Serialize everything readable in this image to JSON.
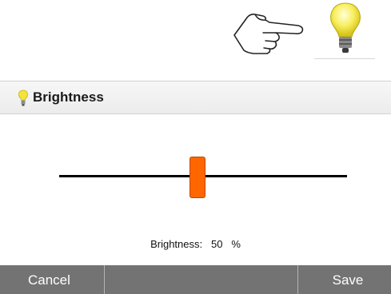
{
  "icons": {
    "pointer": "pointing-hand-icon",
    "lightbulb": "lightbulb-icon"
  },
  "dialog": {
    "title": "Brightness",
    "brightness_label": "Brightness:",
    "brightness_value": "50",
    "brightness_unit": "%"
  },
  "slider": {
    "value_fraction": 0.48,
    "thumb_color": "#ff6600",
    "track_color": "#000000"
  },
  "buttons": {
    "cancel": "Cancel",
    "save": "Save"
  },
  "colors": {
    "button_bar": "#737373",
    "header_bg": "#ececec"
  }
}
